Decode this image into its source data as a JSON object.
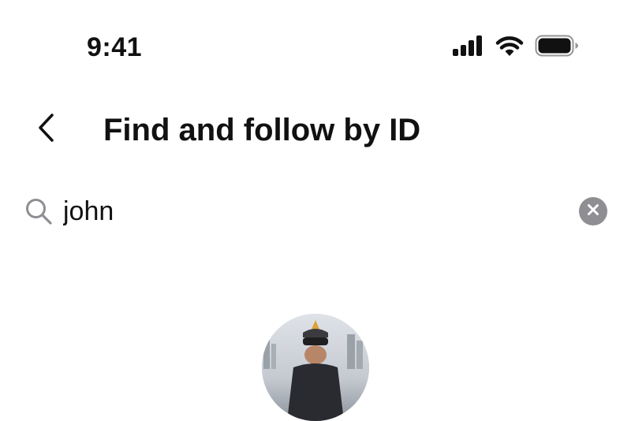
{
  "status_bar": {
    "time": "9:41",
    "icons": [
      "cellular-signal-icon",
      "wifi-icon",
      "battery-icon"
    ]
  },
  "header": {
    "back_icon": "chevron-left-icon",
    "title": "Find and follow by ID"
  },
  "search": {
    "icon": "search-icon",
    "value": "john",
    "clear_icon": "clear-icon"
  },
  "result": {
    "avatar": "profile-photo"
  },
  "colors": {
    "text": "#111111",
    "icon_gray": "#8e8e93",
    "background": "#ffffff"
  }
}
